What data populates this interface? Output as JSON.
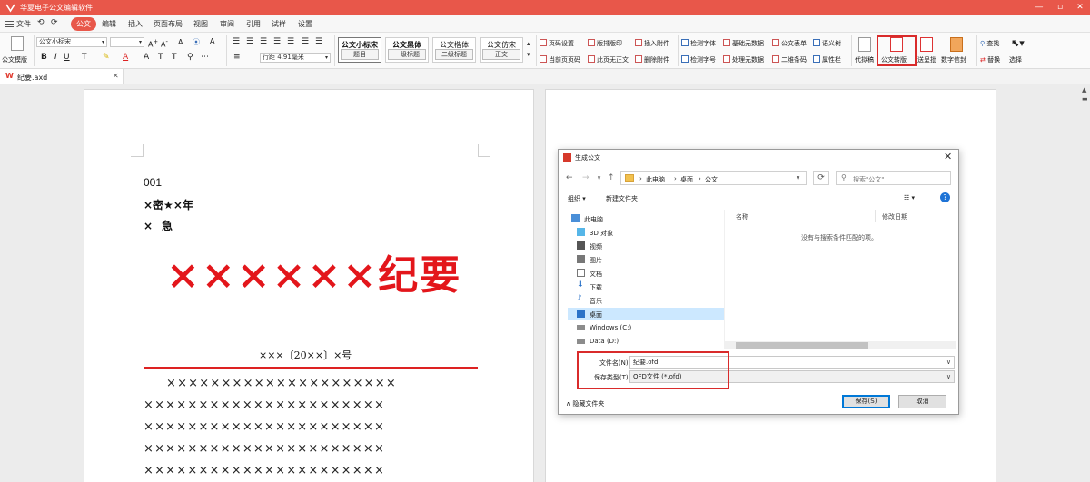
{
  "app": {
    "title": "华夏电子公文编辑软件"
  },
  "window_controls": {
    "minimize": "—",
    "maximize": "▫",
    "close": "✕"
  },
  "menu": {
    "file": "文件",
    "undo": "⟲",
    "redo": "⟳",
    "items": [
      "公文",
      "编辑",
      "插入",
      "页面布局",
      "视图",
      "审阅",
      "引用",
      "试样",
      "设置"
    ],
    "active": "公文"
  },
  "ribbon": {
    "template_button": "公文模版",
    "font_name": "公文小标宋",
    "font_size": "",
    "line_spacing_label": "行距",
    "line_spacing_value": "4.91毫米",
    "styles": [
      {
        "top": "公文小标宋",
        "bottom": "题目"
      },
      {
        "top": "公文黑体",
        "bottom": "一级标题"
      },
      {
        "top": "公文楷体",
        "bottom": "二级标题"
      },
      {
        "top": "公文仿宋",
        "bottom": "正文"
      }
    ],
    "commands_col1": [
      "页码设置",
      "当前页页码"
    ],
    "commands_col2": [
      "版排版印",
      "此页无正文"
    ],
    "commands_col3": [
      "插入附件",
      "删除附件"
    ],
    "commands_col4": [
      "检测字体",
      "检测字号"
    ],
    "commands_col5": [
      "基础元数据",
      "处理元数据"
    ],
    "commands_col6": [
      "公文表单",
      "二维条码"
    ],
    "commands_col7": [
      "语义树",
      "属性栏"
    ],
    "big_buttons": [
      "代拟稿",
      "公文转版",
      "送呈批",
      "数字信封"
    ],
    "find": "查找",
    "replace": "替换",
    "select": "选择"
  },
  "tab": {
    "name": "纪要.axd",
    "close": "✕"
  },
  "document": {
    "number": "001",
    "secret": "×密★×年",
    "urgent": "×急",
    "title": "××××××纪要",
    "doc_no": "×××〔20××〕×号",
    "body_lines": [
      "×××××××××××××××××××××",
      "××××××××××××××××××××××",
      "××××××××××××××××××××××",
      "××××××××××××××××××××××",
      "××××××××××××××××××××××"
    ]
  },
  "dialog": {
    "title": "生成公文",
    "address": [
      "此电脑",
      "桌面",
      "公文"
    ],
    "search_placeholder": "搜索\"公文\"",
    "organize": "组织 ▾",
    "new_folder": "新建文件夹",
    "view_icon": "☷ ▾",
    "help": "?",
    "nav_items": [
      {
        "label": "此电脑",
        "icon": "computer-icon"
      },
      {
        "label": "3D 对象",
        "icon": "cube-icon"
      },
      {
        "label": "视频",
        "icon": "video-icon"
      },
      {
        "label": "图片",
        "icon": "picture-icon"
      },
      {
        "label": "文档",
        "icon": "document-icon"
      },
      {
        "label": "下载",
        "icon": "download-icon"
      },
      {
        "label": "音乐",
        "icon": "music-icon"
      },
      {
        "label": "桌面",
        "icon": "desktop-icon"
      },
      {
        "label": "Windows (C:)",
        "icon": "drive-icon"
      },
      {
        "label": "Data (D:)",
        "icon": "drive-icon"
      }
    ],
    "selected_nav": "桌面",
    "columns": {
      "name": "名称",
      "date": "修改日期"
    },
    "empty_message": "没有与搜索条件匹配的项。",
    "filename_label": "文件名(N):",
    "filename_value": "纪要.ofd",
    "filetype_label": "保存类型(T):",
    "filetype_value": "OFD文件 (*.ofd)",
    "hide_folders": "隐藏文件夹",
    "save_button": "保存(S)",
    "cancel_button": "取消"
  },
  "colors": {
    "title_bar": "#e8574a",
    "accent_red": "#d92b2b",
    "doc_title_red": "#e3161b",
    "selection_blue": "#cce8ff"
  }
}
